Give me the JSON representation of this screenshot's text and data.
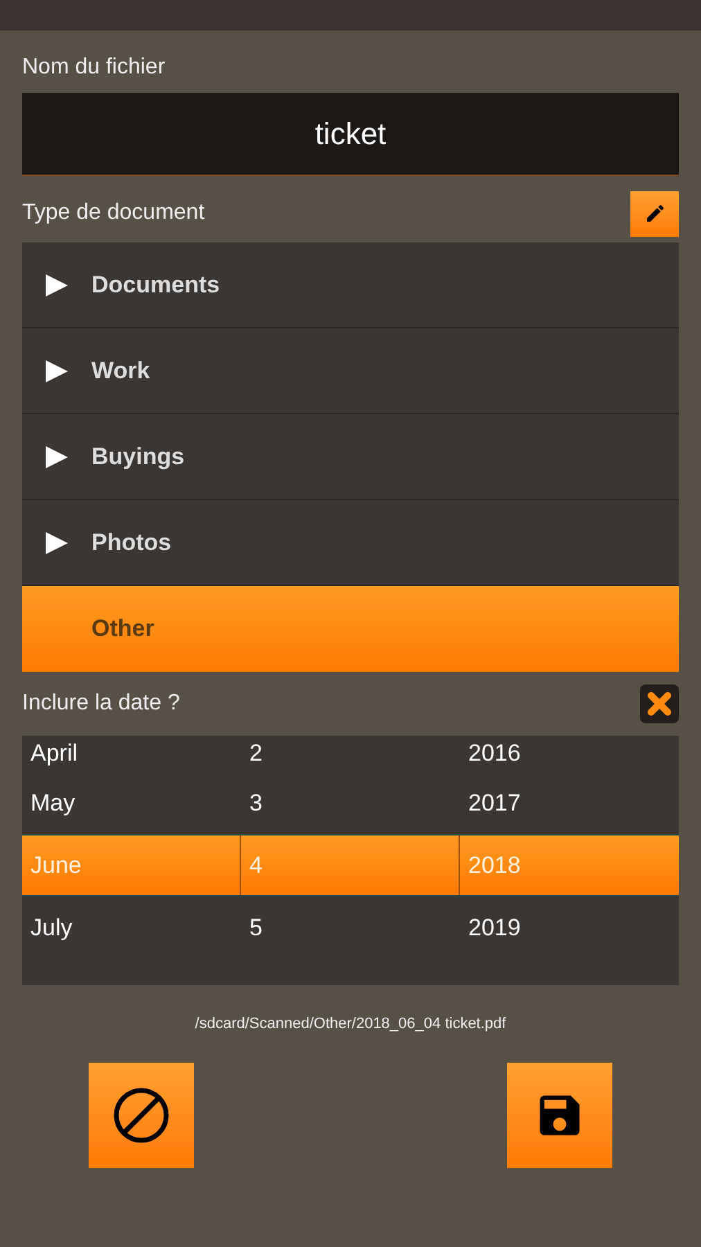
{
  "file_name": {
    "label": "Nom du fichier",
    "value": "ticket"
  },
  "document_type": {
    "label": "Type de document",
    "items": [
      {
        "label": "Documents",
        "expandable": true,
        "selected": false
      },
      {
        "label": "Work",
        "expandable": true,
        "selected": false
      },
      {
        "label": "Buyings",
        "expandable": true,
        "selected": false
      },
      {
        "label": "Photos",
        "expandable": true,
        "selected": false
      },
      {
        "label": "Other",
        "expandable": false,
        "selected": true
      }
    ]
  },
  "include_date": {
    "label": "Inclure la date ?",
    "rows": [
      {
        "month": "April",
        "day": "2",
        "year": "2016",
        "selected": false,
        "clipped": true
      },
      {
        "month": "May",
        "day": "3",
        "year": "2017",
        "selected": false,
        "clipped": false
      },
      {
        "month": "June",
        "day": "4",
        "year": "2018",
        "selected": true,
        "clipped": false
      },
      {
        "month": "July",
        "day": "5",
        "year": "2019",
        "selected": false,
        "clipped": false
      }
    ]
  },
  "output_path": "/sdcard/Scanned/Other/2018_06_04 ticket.pdf",
  "buttons": [
    {
      "kind": "cancel"
    },
    {
      "kind": "save"
    }
  ]
}
